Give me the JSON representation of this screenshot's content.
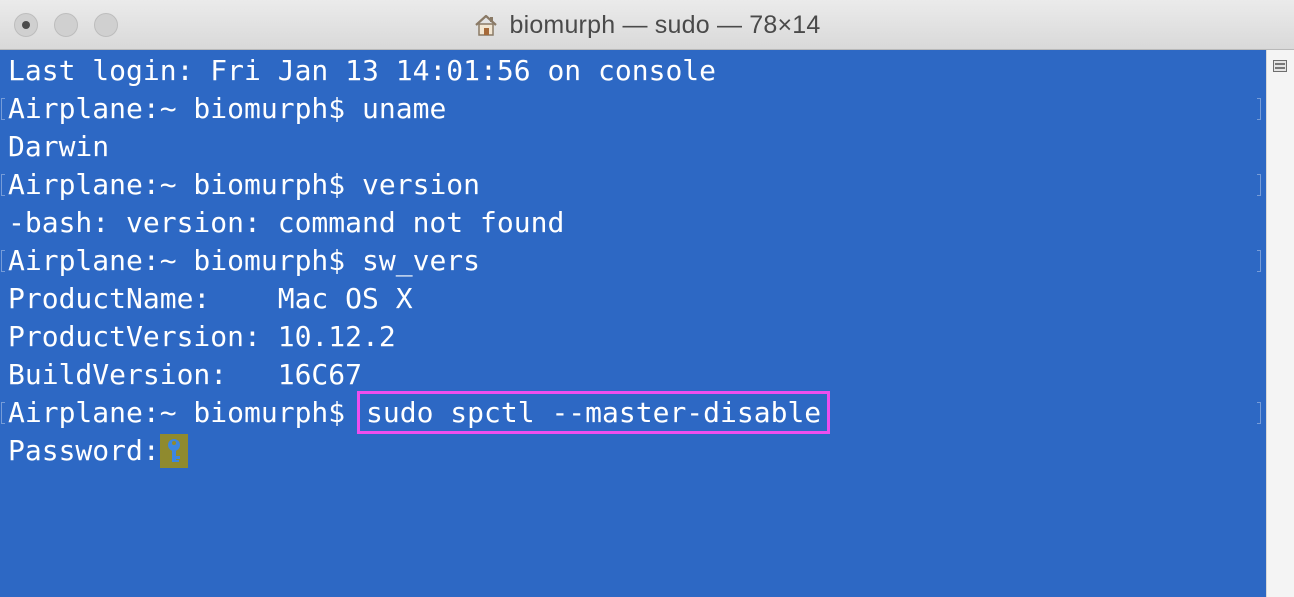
{
  "window": {
    "title": "biomurph — sudo — 78×14",
    "title_icon": "home-icon",
    "background_color": "#2d68c4",
    "text_color": "#ffffff",
    "highlight_color": "#ee4eee"
  },
  "terminal": {
    "lines": [
      {
        "text": "Last login: Fri Jan 13 14:01:56 on console"
      },
      {
        "prompt": "Airplane:~ biomurph$ ",
        "command": "uname"
      },
      {
        "text": "Darwin"
      },
      {
        "prompt": "Airplane:~ biomurph$ ",
        "command": "version"
      },
      {
        "text": "-bash: version: command not found"
      },
      {
        "prompt": "Airplane:~ biomurph$ ",
        "command": "sw_vers"
      },
      {
        "text": "ProductName:    Mac OS X"
      },
      {
        "text": "ProductVersion: 10.12.2"
      },
      {
        "text": "BuildVersion:   16C67"
      },
      {
        "prompt": "Airplane:~ biomurph$ ",
        "command": "sudo spctl --master-disable"
      },
      {
        "text": "Password:",
        "cursor": "key-icon"
      }
    ]
  }
}
